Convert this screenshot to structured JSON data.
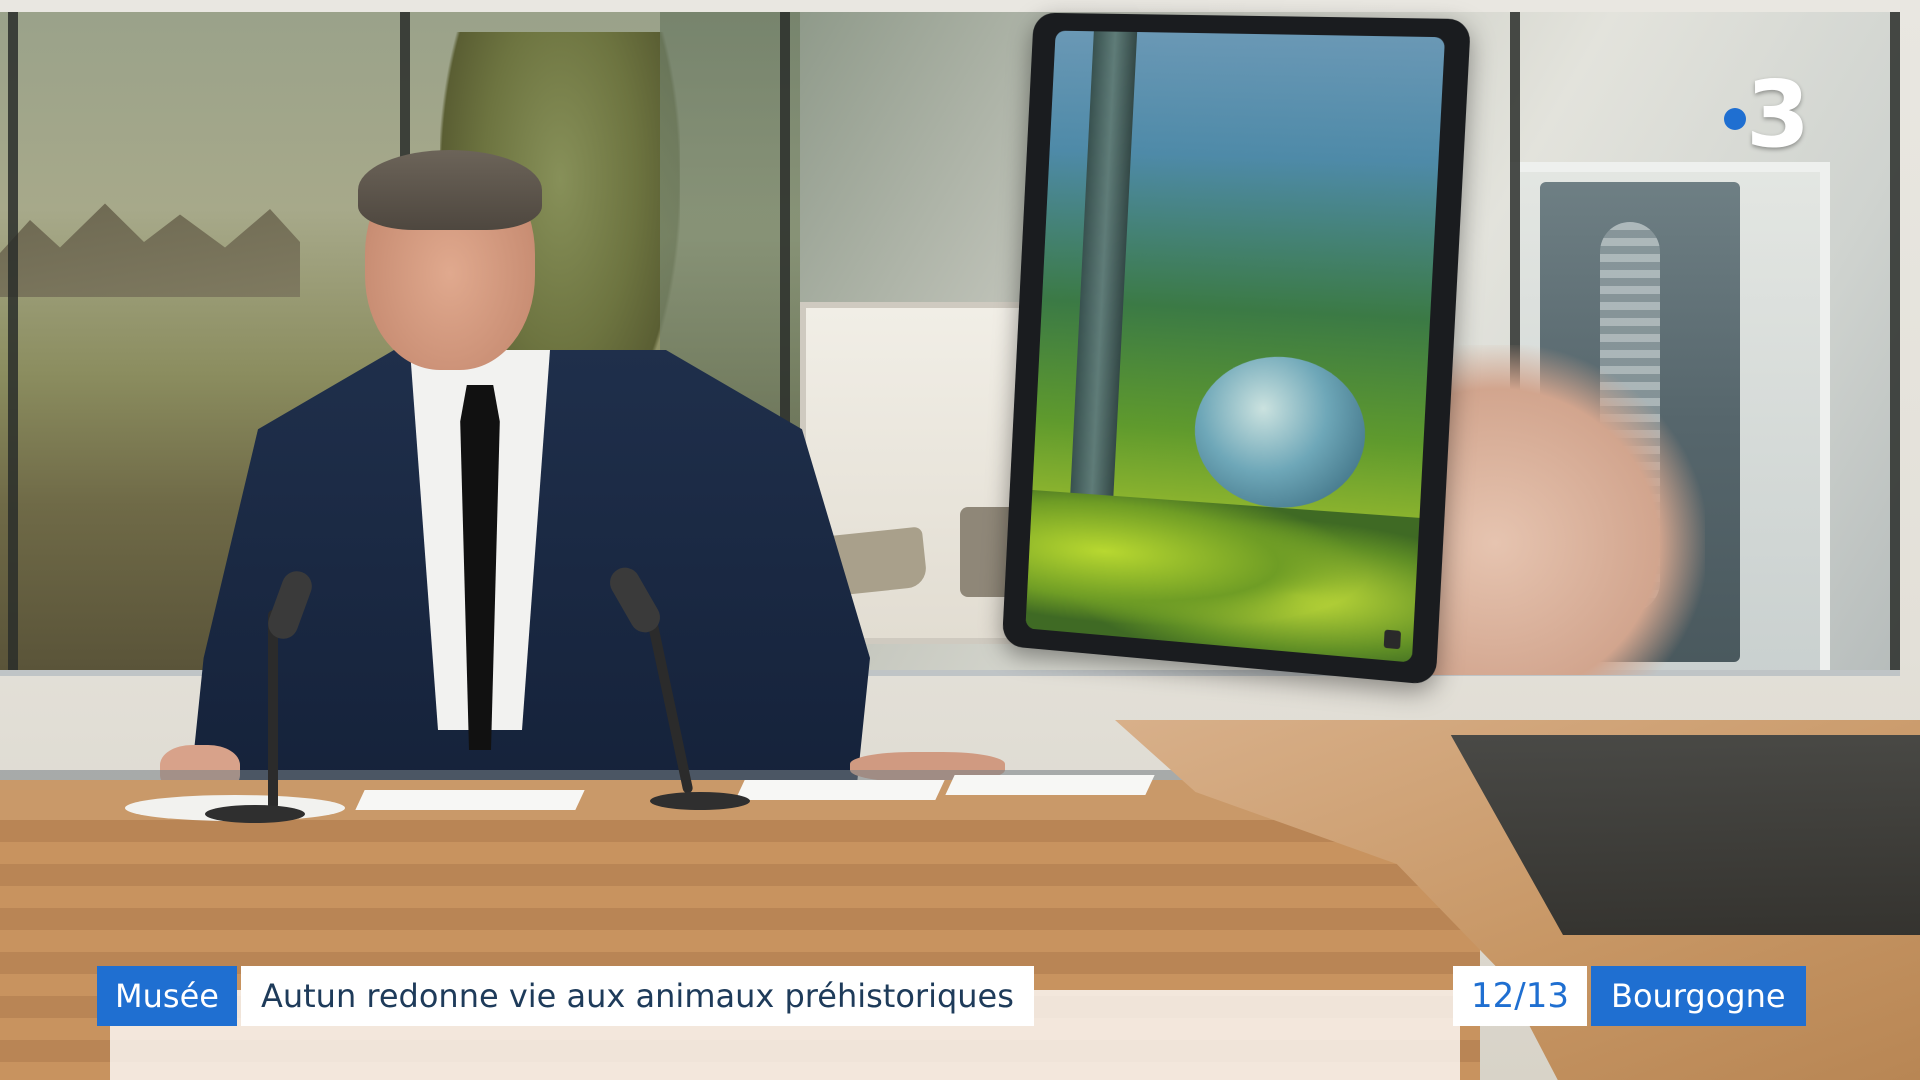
{
  "channel": {
    "logo_number": "3",
    "logo_dot_color": "#1f6fd1"
  },
  "lower_third": {
    "category": "Musée",
    "headline": "Autun redonne vie aux animaux préhistoriques",
    "category_color": "#1f6fd1"
  },
  "program": {
    "edition": "12/13",
    "region": "Bourgogne"
  },
  "icons": {
    "channel_logo": "france-3-logo",
    "tablet_info": "info-icon"
  }
}
